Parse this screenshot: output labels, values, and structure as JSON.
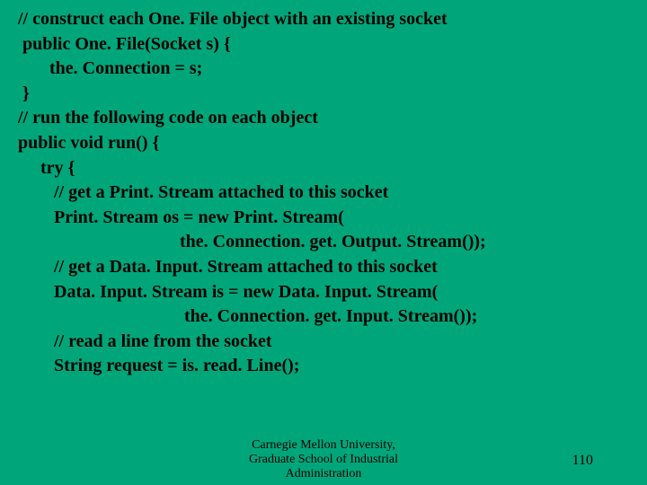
{
  "lines": {
    "l0": "// construct each One. File object with an existing socket",
    "l1": " public One. File(Socket s) {",
    "l2": "       the. Connection = s;",
    "l3": " }",
    "l4": "",
    "l5": "// run the following code on each object",
    "l6": "public void run() {",
    "l7": "     try {",
    "l8": "        // get a Print. Stream attached to this socket",
    "l9": "        Print. Stream os = new Print. Stream(",
    "l10": "                                    the. Connection. get. Output. Stream());",
    "l11": "        // get a Data. Input. Stream attached to this socket",
    "l12": "        Data. Input. Stream is = new Data. Input. Stream(",
    "l13": "                                     the. Connection. get. Input. Stream());",
    "l14": "        // read a line from the socket",
    "l15": "        String request = is. read. Line();"
  },
  "footer": {
    "line1": "Carnegie Mellon University,",
    "line2": "Graduate School of Industrial",
    "line3": "Administration"
  },
  "pagenum": "110"
}
